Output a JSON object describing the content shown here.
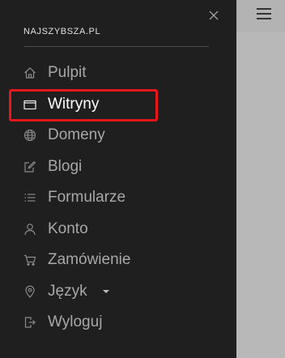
{
  "brand": "NAJSZYBSZA.PL",
  "menu": {
    "items": [
      {
        "label": "Pulpit",
        "icon": "home-icon"
      },
      {
        "label": "Witryny",
        "icon": "window-icon"
      },
      {
        "label": "Domeny",
        "icon": "globe-icon"
      },
      {
        "label": "Blogi",
        "icon": "edit-icon"
      },
      {
        "label": "Formularze",
        "icon": "list-icon"
      },
      {
        "label": "Konto",
        "icon": "user-icon"
      },
      {
        "label": "Zamówienie",
        "icon": "cart-icon"
      },
      {
        "label": "Język",
        "icon": "location-icon",
        "has_dropdown": true
      },
      {
        "label": "Wyloguj",
        "icon": "logout-icon"
      }
    ],
    "active_item": "Witryny"
  },
  "colors": {
    "drawer_bg": "#1f1f1f",
    "page_bg": "#b3b3b3",
    "highlight": "#e8151b",
    "active_text": "#ffffff",
    "text": "#a8a8a8"
  }
}
